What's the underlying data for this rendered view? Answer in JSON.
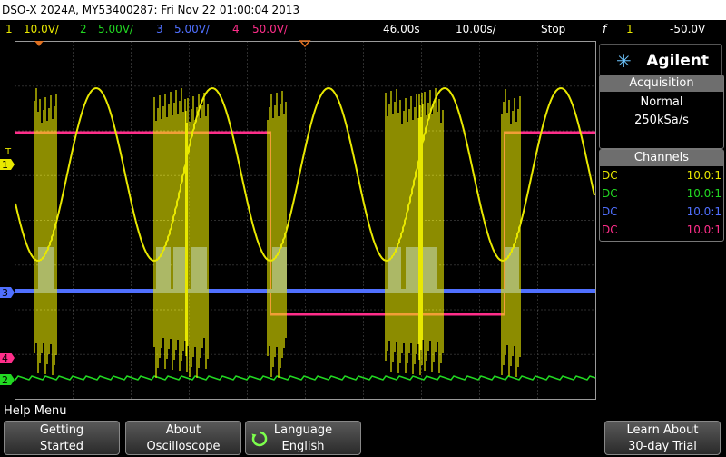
{
  "window": {
    "title": "DSO-X 2024A, MY53400287: Fri Nov 22 01:00:04 2013"
  },
  "status": {
    "ch1": {
      "num": "1",
      "scale": "10.0V/",
      "color": "#e8e800"
    },
    "ch2": {
      "num": "2",
      "scale": "5.00V/",
      "color": "#22d822"
    },
    "ch3": {
      "num": "3",
      "scale": "5.00V/",
      "color": "#5070ff"
    },
    "ch4": {
      "num": "4",
      "scale": "50.0V/",
      "color": "#ff2e8a"
    },
    "delay": "46.00s",
    "timebase": "10.00s/",
    "run_state": "Stop",
    "trigger_symbol": "f",
    "trigger_channel": "1",
    "trigger_level": "-50.0V"
  },
  "brand": {
    "name": "Agilent"
  },
  "acquisition": {
    "header": "Acquisition",
    "mode": "Normal",
    "rate": "250kSa/s"
  },
  "channels": {
    "header": "Channels",
    "rows": [
      {
        "coupling": "DC",
        "probe": "10.0:1",
        "color": "#e8e800"
      },
      {
        "coupling": "DC",
        "probe": "10.0:1",
        "color": "#22d822"
      },
      {
        "coupling": "DC",
        "probe": "10.0:1",
        "color": "#5070ff"
      },
      {
        "coupling": "DC",
        "probe": "10.0:1",
        "color": "#ff2e8a"
      }
    ]
  },
  "markers": {
    "ch1": "1",
    "ch2": "2",
    "ch3": "3",
    "ch4": "4",
    "trigger": "T"
  },
  "help": {
    "label": "Help Menu",
    "keys": {
      "getting_started": [
        "Getting",
        "Started"
      ],
      "about": [
        "About",
        "Oscilloscope"
      ],
      "language": [
        "Language",
        "English"
      ],
      "trial": [
        "Learn About",
        "30-day Trial"
      ]
    }
  }
}
